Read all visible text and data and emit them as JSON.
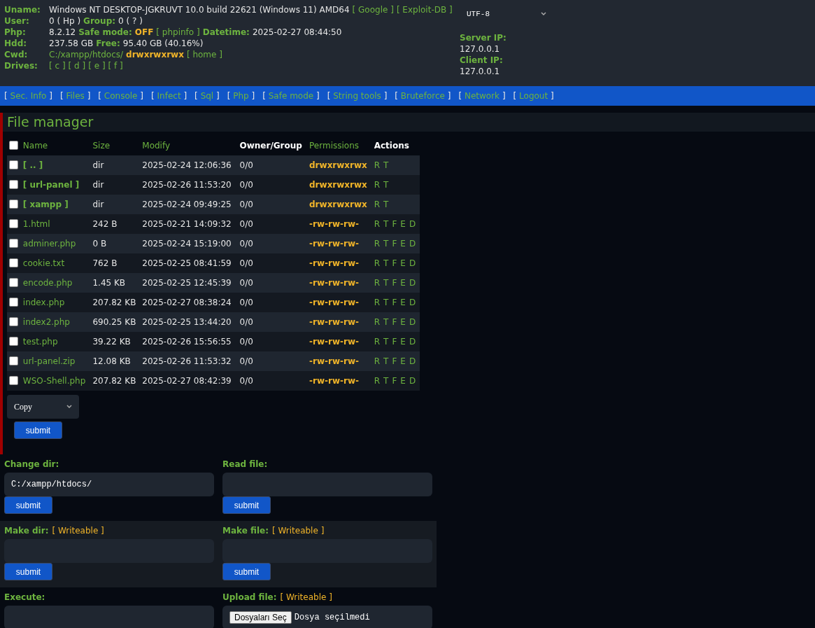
{
  "header": {
    "info": [
      {
        "label": "Uname:",
        "parts": [
          {
            "kind": "text",
            "text": "Windows NT DESKTOP-JGKRUVT 10.0 build 22621 (Windows 11) AMD64"
          },
          {
            "kind": "link",
            "text": "[ Google ]"
          },
          {
            "kind": "link",
            "text": "[ Exploit-DB ]"
          }
        ]
      },
      {
        "label": "User:",
        "parts": [
          {
            "kind": "text",
            "text": "0 ( Hp )"
          },
          {
            "kind": "key",
            "text": "Group:"
          },
          {
            "kind": "text",
            "text": "0 ( ? )"
          }
        ]
      },
      {
        "label": "Php:",
        "parts": [
          {
            "kind": "text",
            "text": "8.2.12"
          },
          {
            "kind": "key",
            "text": "Safe mode:"
          },
          {
            "kind": "warn",
            "text": "OFF"
          },
          {
            "kind": "link",
            "text": "[ phpinfo ]"
          },
          {
            "kind": "key",
            "text": "Datetime:"
          },
          {
            "kind": "text",
            "text": "2025-02-27 08:44:50"
          }
        ]
      },
      {
        "label": "Hdd:",
        "parts": [
          {
            "kind": "text",
            "text": "237.58 GB"
          },
          {
            "kind": "key",
            "text": "Free:"
          },
          {
            "kind": "text",
            "text": "95.40 GB (40.16%)"
          }
        ]
      },
      {
        "label": "Cwd:",
        "parts": [
          {
            "kind": "link",
            "text": "C:/xampp/htdocs/"
          },
          {
            "kind": "warn",
            "text": "drwxrwxrwx"
          },
          {
            "kind": "link",
            "text": "[ home ]"
          }
        ]
      },
      {
        "label": "Drives:",
        "parts": [
          {
            "kind": "link",
            "text": "[ c ]"
          },
          {
            "kind": "link",
            "text": "[ d ]"
          },
          {
            "kind": "link",
            "text": "[ e ]"
          },
          {
            "kind": "link",
            "text": "[ f ]"
          }
        ]
      }
    ],
    "charset": "UTF-8",
    "server_ip": {
      "label": "Server IP:",
      "value": "127.0.0.1"
    },
    "client_ip": {
      "label": "Client IP:",
      "value": "127.0.0.1"
    }
  },
  "nav": [
    {
      "open": "[",
      "label": "Sec. Info",
      "close": "]"
    },
    {
      "open": "[",
      "label": "Files",
      "close": "]"
    },
    {
      "open": "[",
      "label": "Console",
      "close": "]"
    },
    {
      "open": "[",
      "label": "Infect",
      "close": "]"
    },
    {
      "open": "[",
      "label": "Sql",
      "close": "]"
    },
    {
      "open": "[",
      "label": "Php",
      "close": "]"
    },
    {
      "open": "[",
      "label": "Safe mode",
      "close": "]"
    },
    {
      "open": "[",
      "label": "String tools",
      "close": "]"
    },
    {
      "open": "[",
      "label": "Bruteforce",
      "close": "]"
    },
    {
      "open": "[",
      "label": "Network",
      "close": "]"
    },
    {
      "open": "[",
      "label": "Logout",
      "close": "]"
    }
  ],
  "file_manager": {
    "title": "File manager",
    "select_all_checked": false,
    "columns": [
      {
        "label": "Name",
        "sortable": true
      },
      {
        "label": "Size",
        "sortable": true
      },
      {
        "label": "Modify",
        "sortable": true
      },
      {
        "label": "Owner/Group",
        "sortable": false
      },
      {
        "label": "Permissions",
        "sortable": true
      },
      {
        "label": "Actions",
        "sortable": false
      }
    ],
    "rows": [
      {
        "checked": false,
        "kind": "dir",
        "name": "[ .. ]",
        "size": "dir",
        "modify": "2025-02-24 12:06:36",
        "owner": "0/0",
        "permissions": "drwxrwxrwx",
        "actions": [
          "R",
          "T"
        ]
      },
      {
        "checked": false,
        "kind": "dir",
        "name": "[ url-panel ]",
        "size": "dir",
        "modify": "2025-02-26 11:53:20",
        "owner": "0/0",
        "permissions": "drwxrwxrwx",
        "actions": [
          "R",
          "T"
        ]
      },
      {
        "checked": false,
        "kind": "dir",
        "name": "[ xampp ]",
        "size": "dir",
        "modify": "2025-02-24 09:49:25",
        "owner": "0/0",
        "permissions": "drwxrwxrwx",
        "actions": [
          "R",
          "T"
        ]
      },
      {
        "checked": false,
        "kind": "file",
        "name": "1.html",
        "size": "242 B",
        "modify": "2025-02-21 14:09:32",
        "owner": "0/0",
        "permissions": "-rw-rw-rw-",
        "actions": [
          "R",
          "T",
          "F",
          "E",
          "D"
        ]
      },
      {
        "checked": false,
        "kind": "file",
        "name": "adminer.php",
        "size": "0 B",
        "modify": "2025-02-24 15:19:00",
        "owner": "0/0",
        "permissions": "-rw-rw-rw-",
        "actions": [
          "R",
          "T",
          "F",
          "E",
          "D"
        ]
      },
      {
        "checked": false,
        "kind": "file",
        "name": "cookie.txt",
        "size": "762 B",
        "modify": "2025-02-25 08:41:59",
        "owner": "0/0",
        "permissions": "-rw-rw-rw-",
        "actions": [
          "R",
          "T",
          "F",
          "E",
          "D"
        ]
      },
      {
        "checked": false,
        "kind": "file",
        "name": "encode.php",
        "size": "1.45 KB",
        "modify": "2025-02-25 12:45:39",
        "owner": "0/0",
        "permissions": "-rw-rw-rw-",
        "actions": [
          "R",
          "T",
          "F",
          "E",
          "D"
        ]
      },
      {
        "checked": false,
        "kind": "file",
        "name": "index.php",
        "size": "207.82 KB",
        "modify": "2025-02-27 08:38:24",
        "owner": "0/0",
        "permissions": "-rw-rw-rw-",
        "actions": [
          "R",
          "T",
          "F",
          "E",
          "D"
        ]
      },
      {
        "checked": false,
        "kind": "file",
        "name": "index2.php",
        "size": "690.25 KB",
        "modify": "2025-02-25 13:44:20",
        "owner": "0/0",
        "permissions": "-rw-rw-rw-",
        "actions": [
          "R",
          "T",
          "F",
          "E",
          "D"
        ]
      },
      {
        "checked": false,
        "kind": "file",
        "name": "test.php",
        "size": "39.22 KB",
        "modify": "2025-02-26 15:56:55",
        "owner": "0/0",
        "permissions": "-rw-rw-rw-",
        "actions": [
          "R",
          "T",
          "F",
          "E",
          "D"
        ]
      },
      {
        "checked": false,
        "kind": "file",
        "name": "url-panel.zip",
        "size": "12.08 KB",
        "modify": "2025-02-26 11:53:32",
        "owner": "0/0",
        "permissions": "-rw-rw-rw-",
        "actions": [
          "R",
          "T",
          "F",
          "E",
          "D"
        ]
      },
      {
        "checked": false,
        "kind": "file",
        "name": "WSO-Shell.php",
        "size": "207.82 KB",
        "modify": "2025-02-27 08:42:39",
        "owner": "0/0",
        "permissions": "-rw-rw-rw-",
        "actions": [
          "R",
          "T",
          "F",
          "E",
          "D"
        ]
      }
    ],
    "bulk_action": "Copy",
    "submit": "submit"
  },
  "forms": [
    {
      "shaded": false,
      "items": [
        {
          "kind": "text",
          "label": "Change dir:",
          "value": "C:/xampp/htdocs/",
          "button": "submit"
        },
        {
          "kind": "text",
          "label": "Read file:",
          "button": "submit"
        }
      ]
    },
    {
      "shaded": true,
      "items": [
        {
          "kind": "text",
          "label": "Make dir:",
          "badge": "[ Writeable ]",
          "button": "submit"
        },
        {
          "kind": "text",
          "label": "Make file:",
          "badge": "[ Writeable ]",
          "button": "submit"
        }
      ]
    },
    {
      "shaded": false,
      "items": [
        {
          "kind": "text",
          "label": "Execute:"
        },
        {
          "kind": "file",
          "label": "Upload file:",
          "badge": "[ Writeable ]",
          "choose": "Dosyaları Seç",
          "status": "Dosya seçilmedi"
        }
      ]
    }
  ]
}
